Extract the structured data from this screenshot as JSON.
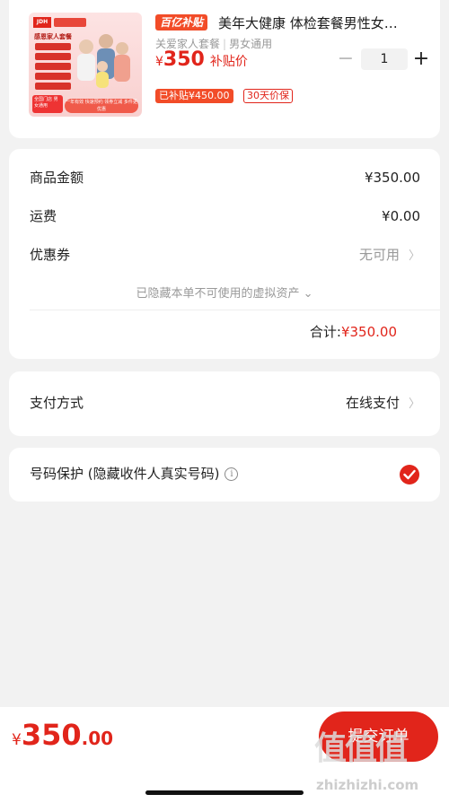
{
  "product": {
    "badge": "百亿补贴",
    "title": "美年大健康 体检套餐男性女…",
    "sub_tag_a": "关爱家人套餐",
    "sub_tag_b": "男女通用",
    "price_currency": "¥",
    "price_value": "350",
    "price_label": "补贴价",
    "quantity": "1",
    "minus_label": "−",
    "plus_label": "+",
    "subsidy_tag": "已补贴¥450.00",
    "guarantee_tag": "30天价保",
    "thumb_logo": "JDH",
    "thumb_title": "感恩家人套餐",
    "thumb_tag": "全国门店 男女通用",
    "thumb_band": "一年有效 快速预约 领券立减 多件更优惠"
  },
  "summary": {
    "goods_label": "商品金额",
    "goods_value": "¥350.00",
    "shipping_label": "运费",
    "shipping_value": "¥0.00",
    "coupon_label": "优惠券",
    "coupon_value": "无可用",
    "hidden_assets_note": "已隐藏本单不可使用的虚拟资产 ⌄",
    "total_label": "合计:",
    "total_value": "¥350.00"
  },
  "payment": {
    "label": "支付方式",
    "value": "在线支付"
  },
  "privacy": {
    "label": "号码保护 (隐藏收件人真实号码)",
    "info_glyph": "i",
    "checked": true
  },
  "bottom_bar": {
    "currency": "¥",
    "total_int": "350",
    "total_dec": ".00",
    "submit_label": "提交订单"
  },
  "watermark": {
    "text": "值值值",
    "url": "zhizhizhi.com"
  },
  "colors": {
    "accent": "#e1251b",
    "badge": "#f24c28",
    "background": "#f2f2f2"
  }
}
